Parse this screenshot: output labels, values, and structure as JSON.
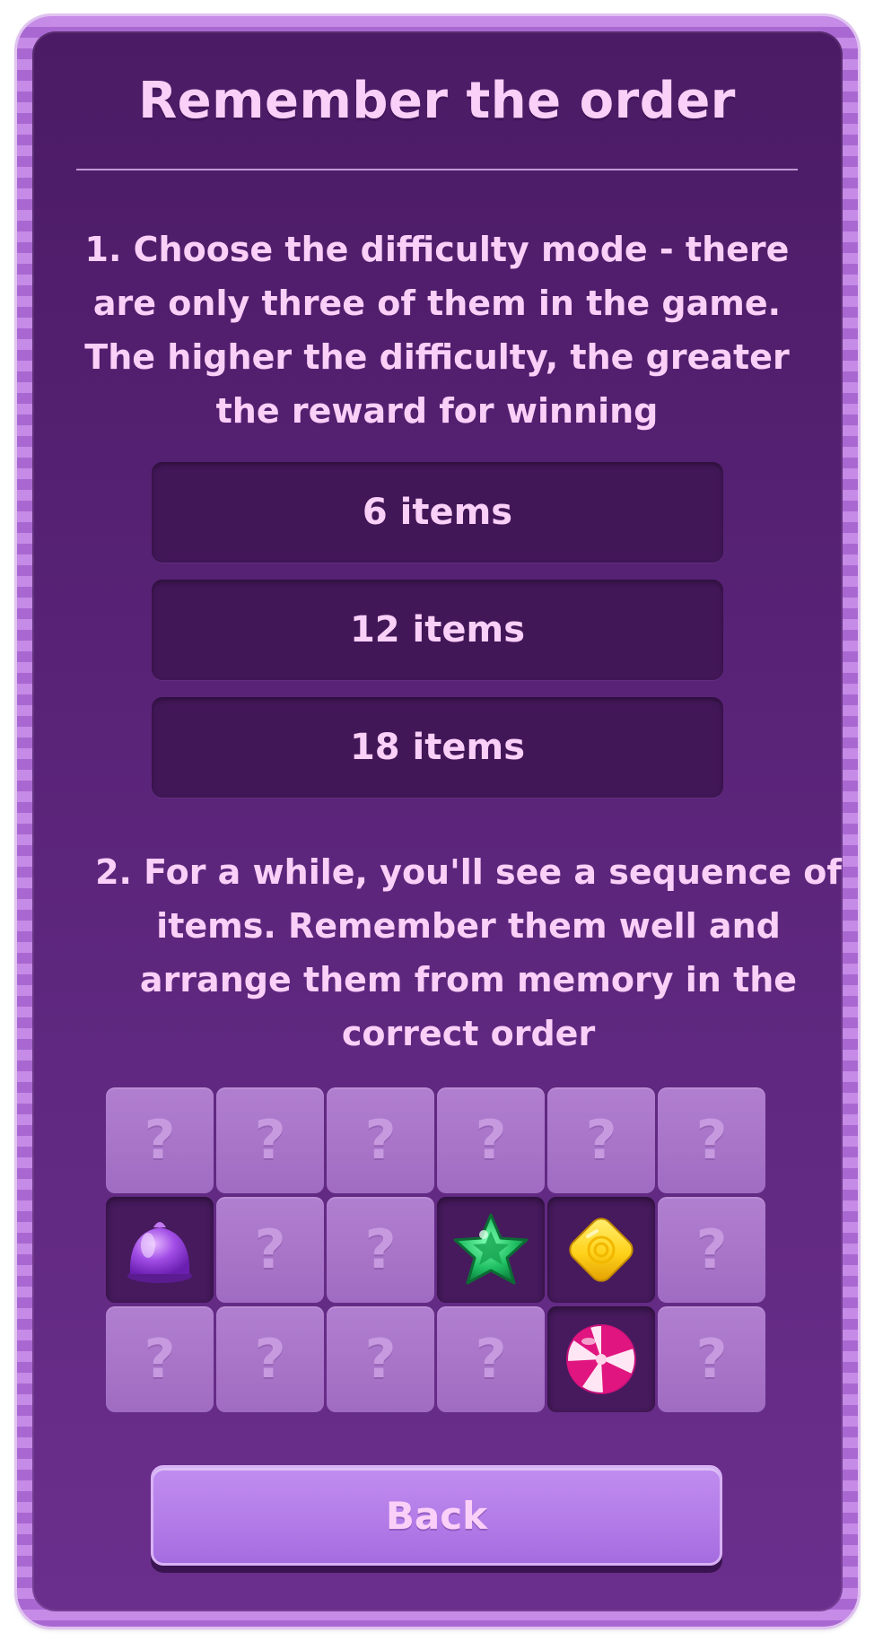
{
  "title": "Remember the order",
  "instructions": {
    "step1": "1. Choose the difficulty mode - there are only three of them in the game. The higher the difficulty, the greater the reward for winning",
    "step2": "2.  For a while, you'll see a sequence of items. Remember them well and arrange them from memory in the correct order"
  },
  "modes": [
    {
      "label": "6 items"
    },
    {
      "label": "12 items"
    },
    {
      "label": "18 items"
    }
  ],
  "grid": {
    "hidden_symbol": "?",
    "cells": [
      "hidden",
      "hidden",
      "hidden",
      "hidden",
      "hidden",
      "hidden",
      "purple-jelly",
      "hidden",
      "hidden",
      "green-star-candy",
      "yellow-swirl-candy",
      "hidden",
      "hidden",
      "hidden",
      "hidden",
      "hidden",
      "pink-peppermint-candy",
      "hidden"
    ]
  },
  "back_label": "Back",
  "colors": {
    "panel": "#5a2479",
    "text": "#fbd0f8",
    "mode_button": "#421758",
    "tile": "#b17fd0",
    "back_button": "#b37ce8"
  }
}
